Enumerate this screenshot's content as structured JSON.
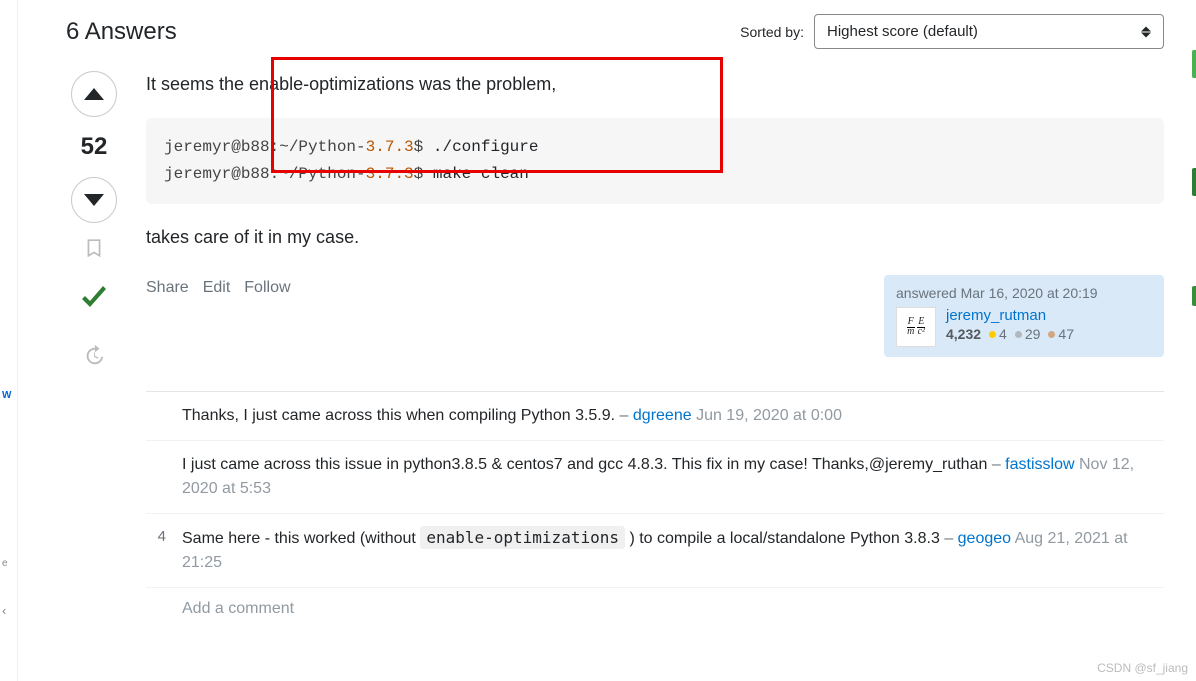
{
  "header": {
    "title": "6 Answers",
    "sorted_by_label": "Sorted by:",
    "sort_value": "Highest score (default)"
  },
  "answer": {
    "score": "52",
    "body_intro": "It seems the enable-optimizations was the problem,",
    "code_prefix1": "jeremyr@b88:~/Python-",
    "code_version": "3.7.3",
    "code_suffix1": " ./configure",
    "code_prefix2": "jeremyr@b88:~/Python-",
    "code_suffix2": " make clean",
    "body_outro": "takes care of it in my case.",
    "actions": {
      "share": "Share",
      "edit": "Edit",
      "follow": "Follow"
    },
    "usercard": {
      "time_prefix": "answered ",
      "time": "Mar 16, 2020 at 20:19",
      "name": "jeremy_rutman",
      "rep": "4,232",
      "gold": "4",
      "silver": "29",
      "bronze": "47"
    }
  },
  "comments": [
    {
      "score": "",
      "text": "Thanks, I just came across this when compiling Python 3.5.9.",
      "user": "dgreene",
      "date": "Jun 19, 2020 at 0:00"
    },
    {
      "score": "",
      "text": "I just came across this issue in python3.8.5 & centos7 and gcc 4.8.3. This fix in my case! Thanks,@jeremy_ruthan",
      "user": "fastisslow",
      "date": "Nov 12, 2020 at 5:53"
    },
    {
      "score": "4",
      "text_pre": "Same here - this worked (without ",
      "code": "enable-optimizations",
      "text_post": " ) to compile a local/standalone Python 3.8.3",
      "user": "geogeo",
      "date": "Aug 21, 2021 at 21:25"
    }
  ],
  "add_comment": "Add a comment",
  "watermark": "CSDN @sf_jiang"
}
